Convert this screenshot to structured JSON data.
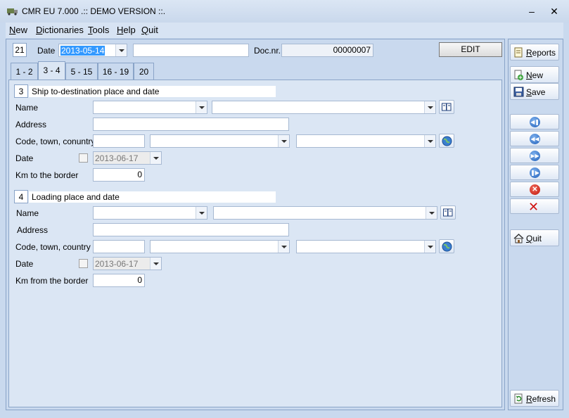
{
  "window": {
    "title": "CMR EU 7.000 .:: DEMO VERSION ::."
  },
  "menu": [
    "New",
    "Dictionaries",
    "Tools",
    "Help",
    "Quit"
  ],
  "header": {
    "box_number": "21",
    "date_label": "Date",
    "date_value": "2013-05-14",
    "extra_value": "",
    "docnr_label": "Doc.nr.",
    "docnr_value": "00000007",
    "edit_label": "EDIT"
  },
  "tabs": [
    {
      "label": "1 - 2",
      "active": false
    },
    {
      "label": "3 - 4",
      "active": true
    },
    {
      "label": "5 - 15",
      "active": false
    },
    {
      "label": "16 - 19",
      "active": false
    },
    {
      "label": "20",
      "active": false
    }
  ],
  "section3": {
    "number": "3",
    "title": "Ship to-destination place and date",
    "name_label": "Name",
    "address_label": "Address",
    "code_label": "Code, town, conuntry",
    "date_label": "Date",
    "date_value": "2013-06-17",
    "km_label": "Km to the border",
    "km_value": "0"
  },
  "section4": {
    "number": "4",
    "title": "Loading place and date",
    "name_label": "Name",
    "address_label": "Address",
    "code_label": "Code, town, country",
    "date_label": "Date",
    "date_value": "2013-06-17",
    "km_label": "Km from the border",
    "km_value": "0"
  },
  "sidebar": {
    "reports_label": "Reports",
    "new_label": "New",
    "save_label": "Save",
    "quit_label": "Quit",
    "refresh_label": "Refresh"
  },
  "colors": {
    "selection": "#3399ff",
    "frame": "#c9d9ee",
    "panel": "#dbe6f4"
  }
}
